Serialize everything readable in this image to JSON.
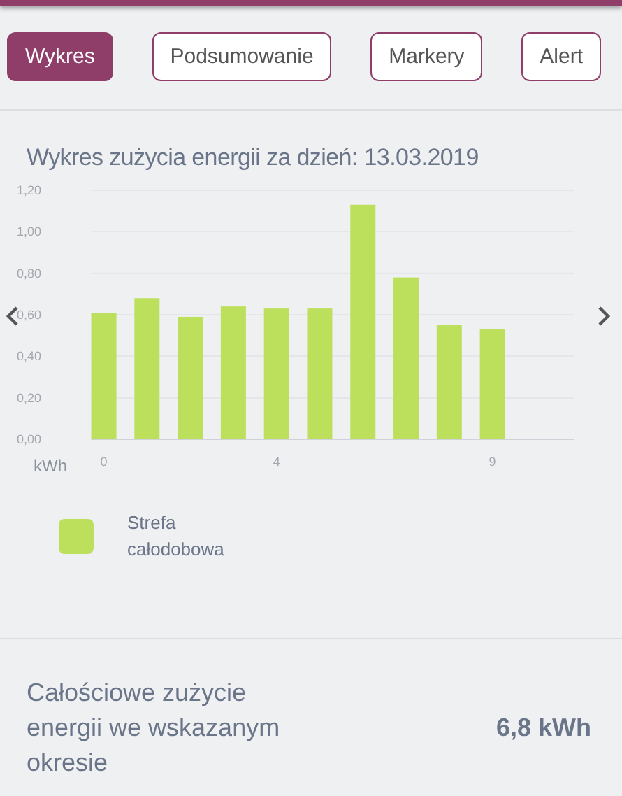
{
  "tabs": [
    {
      "label": "Wykres",
      "selected": true
    },
    {
      "label": "Podsumowanie",
      "selected": false
    },
    {
      "label": "Markery",
      "selected": false
    },
    {
      "label": "Alert",
      "selected": false
    }
  ],
  "chart": {
    "chart_data": {
      "type": "bar",
      "title": "Wykres zużycia energii za dzień: 13.03.2019",
      "ylabel": "kWh",
      "x": [
        0,
        1,
        2,
        3,
        4,
        5,
        6,
        7,
        8,
        9
      ],
      "grid": true,
      "series": [
        {
          "name": "Strefa całodobowa",
          "color": "#bde05c",
          "values": [
            0.61,
            0.68,
            0.59,
            0.64,
            0.63,
            0.63,
            1.13,
            0.78,
            0.55,
            0.53
          ]
        }
      ],
      "ylim": [
        0,
        1.2
      ],
      "yticks": [
        {
          "value": 0,
          "label": "0,00"
        },
        {
          "value": 0.2,
          "label": "0,20"
        },
        {
          "value": 0.4,
          "label": "0,40"
        },
        {
          "value": 0.6,
          "label": "0,60"
        },
        {
          "value": 0.8,
          "label": "0,80"
        },
        {
          "value": 1,
          "label": "1,00"
        },
        {
          "value": 1.2,
          "label": "1,20"
        }
      ],
      "xlim": [
        -0.3,
        10.9
      ],
      "xticks": [
        0,
        4,
        9
      ]
    }
  },
  "summary": {
    "label": "Całościowe zużycie energii we wskazanym okresie",
    "value": "6,8 kWh"
  }
}
